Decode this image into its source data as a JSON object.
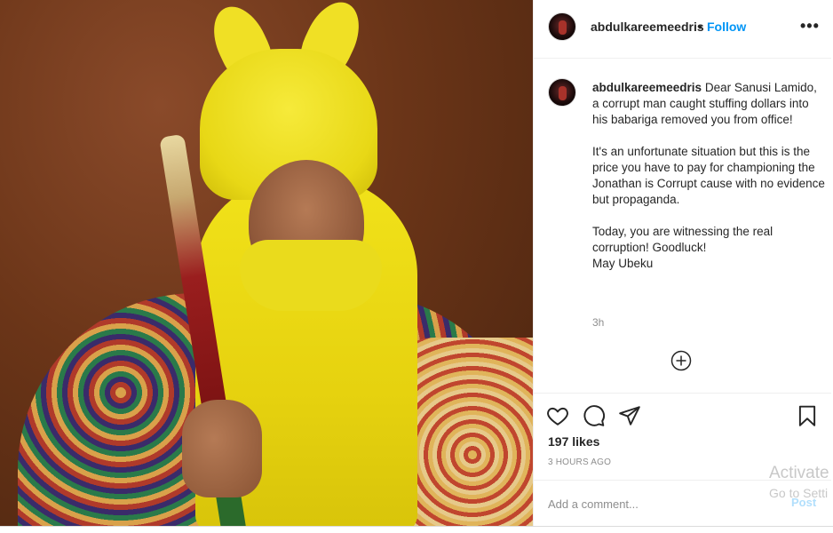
{
  "post": {
    "username": "abdulkareemeedris",
    "separator": "•",
    "follow_label": "Follow",
    "more_label": "•••"
  },
  "caption": {
    "username": "abdulkareemeedris",
    "text": " Dear Sanusi Lamido, a corrupt man caught stuffing dollars into his babariga removed you from office!\n\nIt's an unfortunate situation but this is the price you have to pay for championing the Jonathan is Corrupt cause with no evidence but propaganda.\n\nToday, you are witnessing the real corruption! Goodluck!\nMay Ubeku",
    "time": "3h"
  },
  "actions": {
    "likes": "197 likes",
    "posted_ago": "3 HOURS AGO"
  },
  "comment": {
    "placeholder": "Add a comment...",
    "post_label": "Post"
  },
  "watermark": {
    "line1": "Activate",
    "line2": "Go to Setti"
  },
  "icons": {
    "like": "heart-icon",
    "comment": "comment-icon",
    "share": "paper-plane-icon",
    "save": "bookmark-icon",
    "load_more": "plus-circle-icon"
  }
}
